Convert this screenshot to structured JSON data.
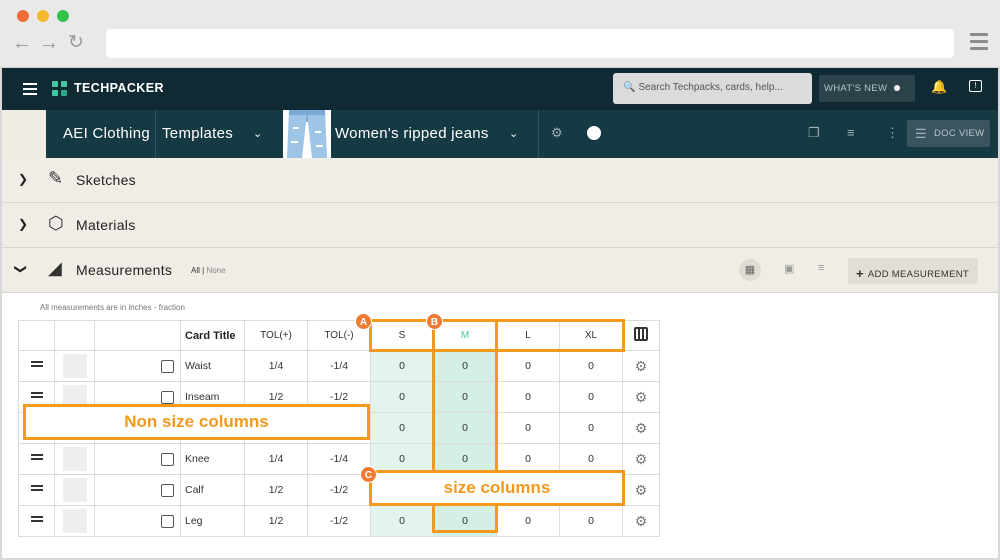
{
  "browser": {
    "url": ""
  },
  "app": {
    "brand": "TECHPACKER"
  },
  "topbar": {
    "search_placeholder": "Search Techpacks, cards, help...",
    "whats_new": "WHAT'S NEW"
  },
  "toolbar": {
    "company": "AEI Clothing",
    "folder": "Templates",
    "product": "Women's ripped jeans",
    "doc_view": "DOC VIEW"
  },
  "sections": {
    "sketches": "Sketches",
    "materials": "Materials",
    "measurements": "Measurements",
    "filter_all": "All",
    "filter_sep": "|",
    "filter_none": "None",
    "add_measurement": "ADD MEASUREMENT"
  },
  "measurements": {
    "note": "All measurements are in inches - fraction",
    "headers": {
      "card_title": "Card Title",
      "tol_plus": "TOL(+)",
      "tol_minus": "TOL(-)",
      "sizes": [
        "S",
        "M",
        "L",
        "XL"
      ]
    },
    "rows": [
      {
        "title": "Waist",
        "tol_plus": "1/4",
        "tol_minus": "-1/4",
        "s": "0",
        "m": "0",
        "l": "0",
        "xl": "0"
      },
      {
        "title": "Inseam",
        "tol_plus": "1/2",
        "tol_minus": "-1/2",
        "s": "0",
        "m": "0",
        "l": "0",
        "xl": "0"
      },
      {
        "title": "",
        "tol_plus": "",
        "tol_minus": "",
        "s": "0",
        "m": "0",
        "l": "0",
        "xl": "0"
      },
      {
        "title": "Knee",
        "tol_plus": "1/4",
        "tol_minus": "-1/4",
        "s": "0",
        "m": "0",
        "l": "0",
        "xl": "0"
      },
      {
        "title": "Calf",
        "tol_plus": "1/2",
        "tol_minus": "-1/2",
        "s": "",
        "m": "",
        "l": "",
        "xl": ""
      },
      {
        "title": "Leg",
        "tol_plus": "1/2",
        "tol_minus": "-1/2",
        "s": "0",
        "m": "0",
        "l": "0",
        "xl": "0"
      }
    ]
  },
  "annotations": {
    "badge_a": "A",
    "badge_b": "B",
    "badge_c": "C",
    "non_size_columns": "Non  size columns",
    "size_columns": "size columns"
  },
  "colors": {
    "accent": "#45c7a6",
    "annotation": "#f39a1d",
    "nav_dark": "#0f2a33"
  }
}
